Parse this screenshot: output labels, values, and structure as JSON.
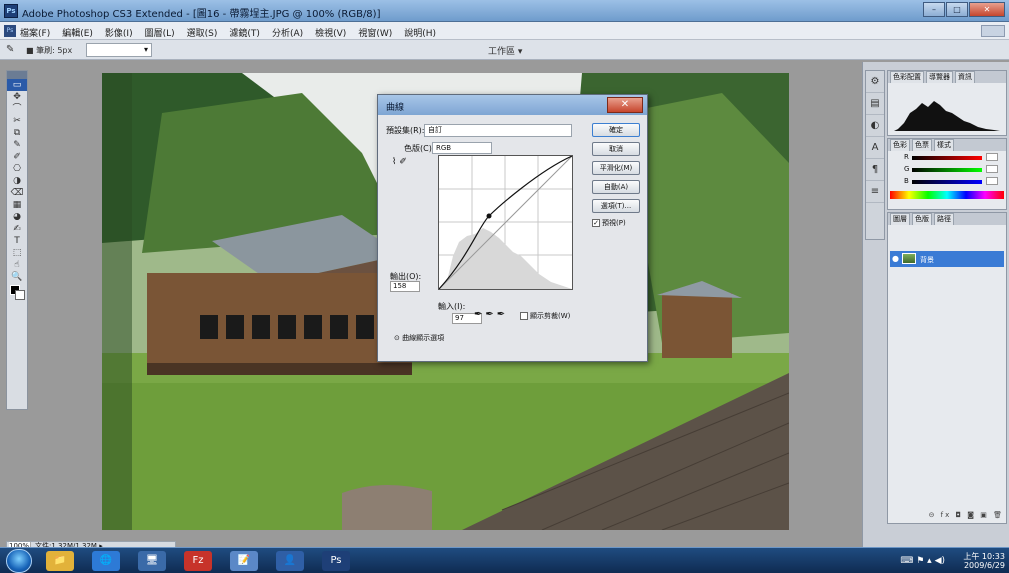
{
  "window": {
    "title": "Adobe Photoshop CS3 Extended - [圖16 - 帶霧埕主.JPG @ 100% (RGB/8)]",
    "app_icon_text": "Ps",
    "controls": {
      "minimize": "–",
      "maximize": "□",
      "close": "✕"
    }
  },
  "menubar": {
    "items": [
      "檔案(F)",
      "編輯(E)",
      "影像(I)",
      "圖層(L)",
      "選取(S)",
      "濾鏡(T)",
      "分析(A)",
      "檢視(V)",
      "視窗(W)",
      "說明(H)"
    ]
  },
  "options_bar": {
    "tool_icon": "✎",
    "label": "■ 筆刷: 5px",
    "dropdown_value": "▾",
    "workspace_label": "工作區 ▾"
  },
  "toolbox": {
    "tools": [
      "▭",
      "✥",
      "⌒",
      "✂",
      "⧉",
      "✎",
      "✐",
      "⎔",
      "◑",
      "⌫",
      "▦",
      "◕",
      "✍",
      "T",
      "⬚",
      "☝",
      "🔍"
    ]
  },
  "dialog": {
    "title": "曲線",
    "close_label": "✕",
    "preset_label": "預設集(R):",
    "preset_value": "自訂",
    "channel_label": "色版(C):",
    "channel_value": "RGB",
    "curve_tools": "⌇ ✐",
    "output_label": "輸出(O):",
    "output_value": "158",
    "input_label": "輸入(I):",
    "input_value": "97",
    "eyedroppers": "✒✒✒",
    "clip_label": "顯示剪裁(W)",
    "curve_options_label": "⊙ 曲線顯示選項",
    "buttons": [
      "確定",
      "取消",
      "平滑化(M)",
      "自動(A)",
      "選項(T)..."
    ],
    "preview_label": "預視(P)",
    "preview_checked": true
  },
  "panels": {
    "side_icons": [
      "⚙",
      "▤",
      "◐",
      "A",
      "¶",
      "≡"
    ],
    "histogram_tabs": [
      "色彩配置",
      "導覽器",
      "資訊"
    ],
    "color_tabs": [
      "色彩",
      "色票",
      "樣式"
    ],
    "color_sliders": [
      {
        "label": "R",
        "value": ""
      },
      {
        "label": "G",
        "value": ""
      },
      {
        "label": "B",
        "value": ""
      }
    ],
    "layers_tabs": [
      "圖層",
      "色版",
      "路徑"
    ],
    "layer_name": "背景",
    "layers_footer": "⊝ fx ◘ ◙ ▣ 🗑"
  },
  "statusbar": {
    "zoom": "100%",
    "text": "文件:1.32M/1.32M ▸"
  },
  "taskbar": {
    "pinned": [
      "📁",
      "🌐",
      "🖥",
      "Fz",
      "📝",
      "👤",
      "Ps"
    ],
    "tray_icons": "⌨ ⚑ ▴ ◀)",
    "time": "上午 10:33",
    "date": "2009/6/29"
  },
  "colors": {
    "title_bar": "#7ea5d3",
    "selected_layer": "#3a7bd5",
    "taskbar": "#1f4c80"
  }
}
